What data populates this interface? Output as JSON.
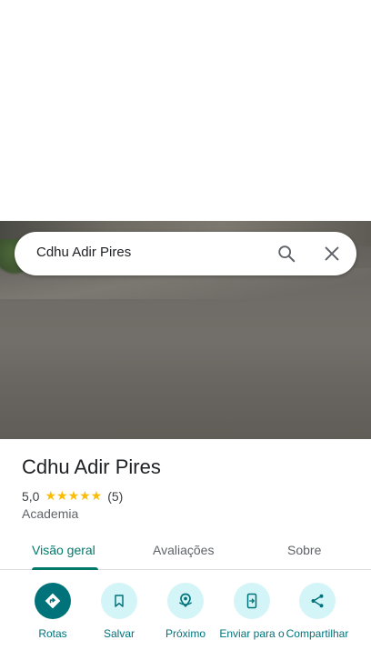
{
  "search": {
    "query": "Cdhu Adir Pires"
  },
  "place": {
    "title": "Cdhu Adir Pires",
    "rating_value": "5,0",
    "stars": "★★★★★",
    "rating_count": "(5)",
    "category": "Academia"
  },
  "tabs": [
    {
      "label": "Visão geral",
      "active": true
    },
    {
      "label": "Avaliações",
      "active": false
    },
    {
      "label": "Sobre",
      "active": false
    }
  ],
  "actions": [
    {
      "label": "Rotas",
      "icon": "directions-icon"
    },
    {
      "label": "Salvar",
      "icon": "bookmark-icon"
    },
    {
      "label": "Próximo",
      "icon": "nearby-icon"
    },
    {
      "label": "Enviar para o",
      "icon": "send-to-phone-icon"
    },
    {
      "label": "Compartilhar",
      "icon": "share-icon"
    }
  ],
  "colors": {
    "accent": "#00796b",
    "action_bg": "#d4f5f7",
    "star": "#fbbc04"
  }
}
